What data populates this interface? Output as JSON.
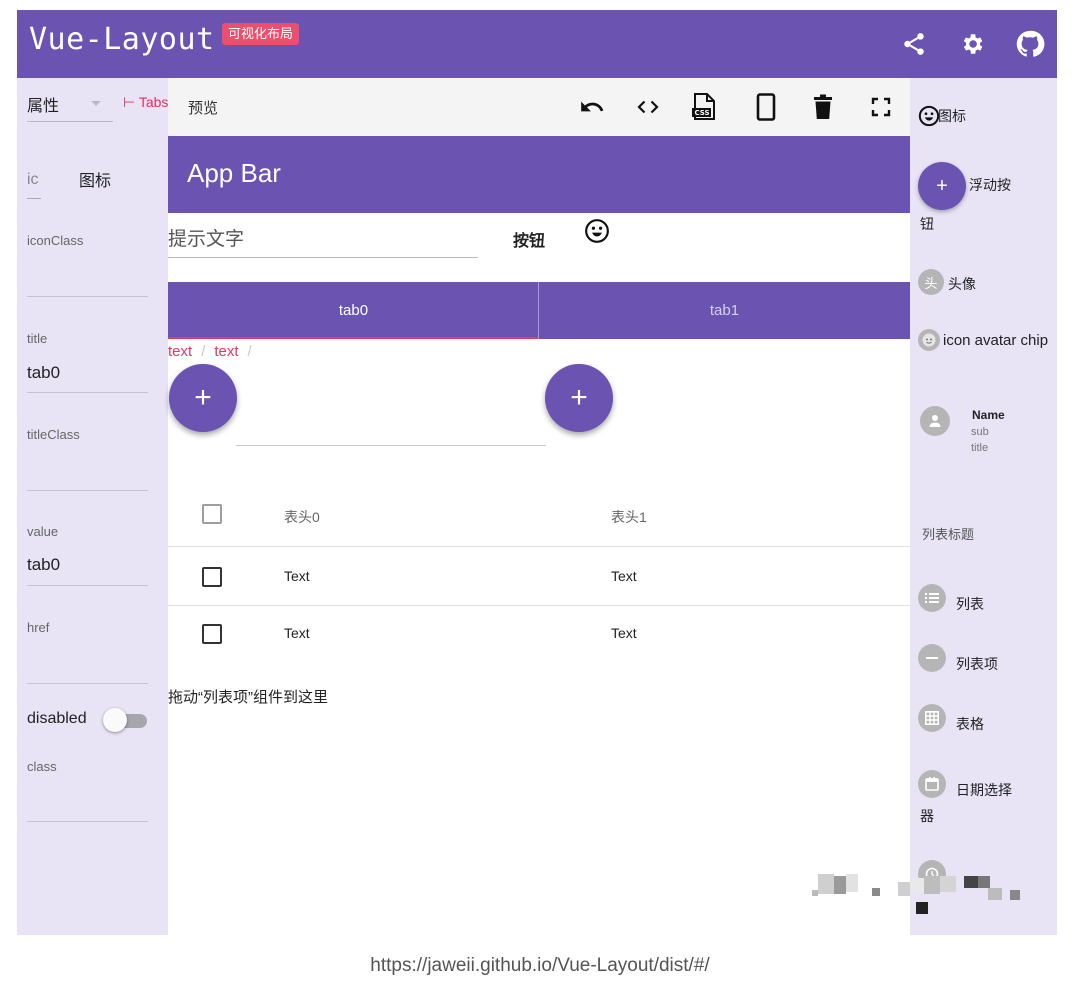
{
  "app": {
    "title": "Vue-Layout",
    "badge": "可视化布局",
    "brand_color": "#6a53b1",
    "badge_color": "#ec4e6e",
    "icons": [
      "share-icon",
      "gear-icon",
      "github-icon"
    ]
  },
  "left_panel": {
    "tab_props": "属性",
    "tab_tabs": "⊢ Tabs",
    "ic_label": "ic",
    "ic_name": "图标",
    "fields": {
      "iconClass": "iconClass",
      "title_label": "title",
      "title_value": "tab0",
      "titleClass": "titleClass",
      "value_label": "value",
      "value_value": "tab0",
      "href": "href",
      "disabled": "disabled",
      "class": "class"
    },
    "disabled_on": false
  },
  "preview": {
    "toolbar_title": "预览",
    "toolbar_icons": [
      "undo-icon",
      "code-icon",
      "css-file-icon",
      "phone-icon",
      "trash-icon",
      "fullscreen-icon"
    ],
    "appbar_title": "App Bar",
    "input_placeholder": "提示文字",
    "button_label": "按钮",
    "tabs": [
      "tab0",
      "tab1"
    ],
    "active_tab": "tab0",
    "breadcrumbs": [
      "text",
      "text"
    ],
    "breadcrumb_sep": "/",
    "fab_symbol": "+",
    "table": {
      "headers": [
        "表头0",
        "表头1"
      ],
      "rows": [
        [
          "Text",
          "Text"
        ],
        [
          "Text",
          "Text"
        ]
      ]
    },
    "drop_hint": "拖动“列表项”组件到这里"
  },
  "palette": {
    "icon_label": "图标",
    "fab_label_1": "浮动按",
    "fab_label_2": "钮",
    "avatar_letter": "头",
    "avatar_label": "头像",
    "chip_label": "icon avatar chip",
    "card_name": "Name",
    "card_sub1": "sub",
    "card_sub2": "title",
    "list_title": "列表标题",
    "list_label": "列表",
    "list_item_label": "列表项",
    "table_label": "表格",
    "date_label_1": "日期选择",
    "date_label_2": "器"
  },
  "footer": {
    "url": "https://jaweii.github.io/Vue-Layout/dist/#/"
  }
}
